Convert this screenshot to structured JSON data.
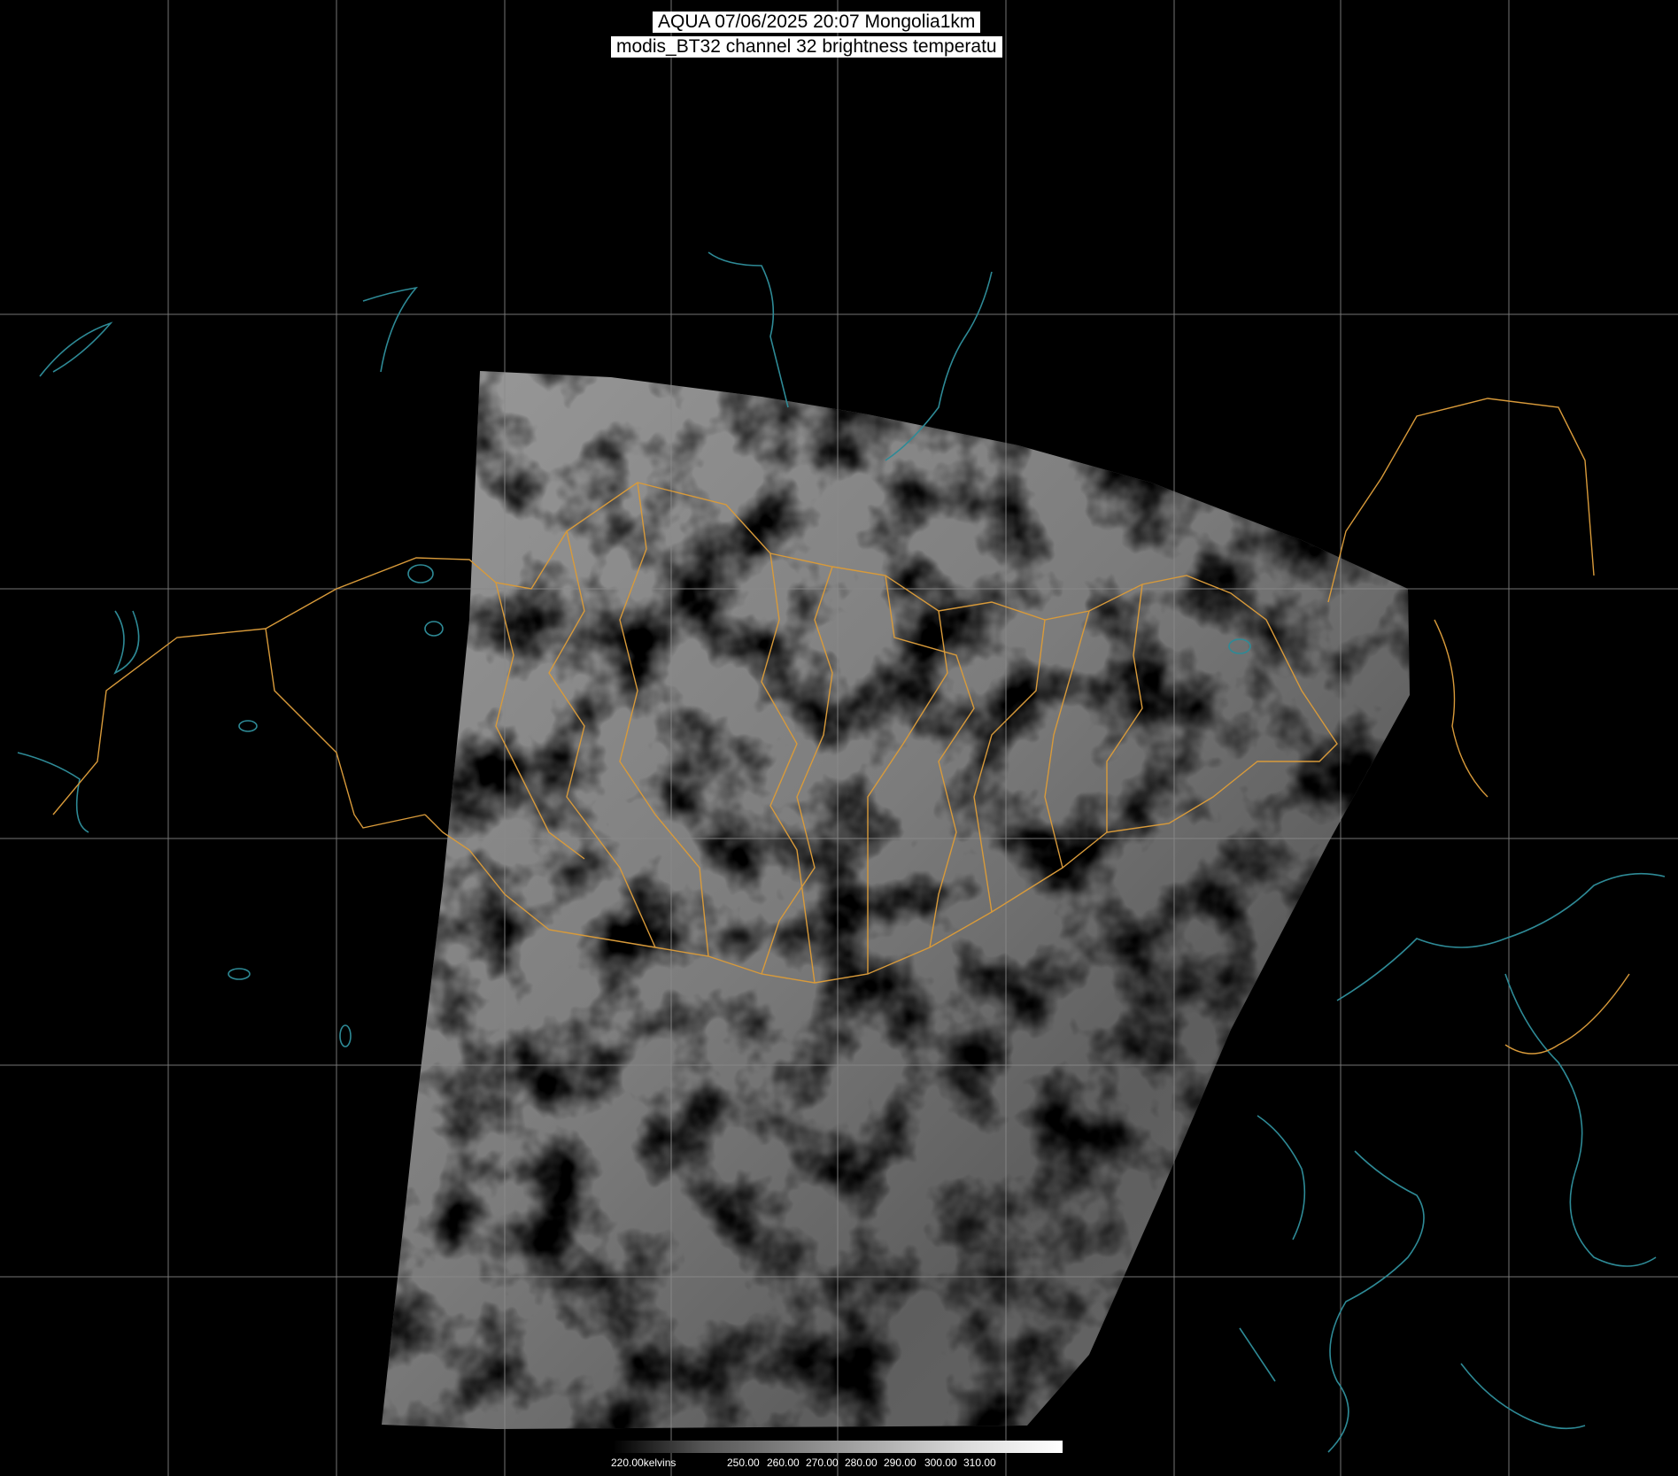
{
  "title": {
    "line1": "AQUA 07/06/2025 20:07 Mongolia1km",
    "line2": "modis_BT32 channel 32 brightness temperatu"
  },
  "colorbar": {
    "labels": [
      "220.00kelvins",
      "250.00",
      "260.00",
      "270.00",
      "280.00",
      "290.00",
      "300.00",
      "310.00"
    ]
  },
  "colors": {
    "background": "#000000",
    "grid": "#8a8a8a",
    "borders": "#d89a3a",
    "coastlines": "#2e8a96"
  }
}
